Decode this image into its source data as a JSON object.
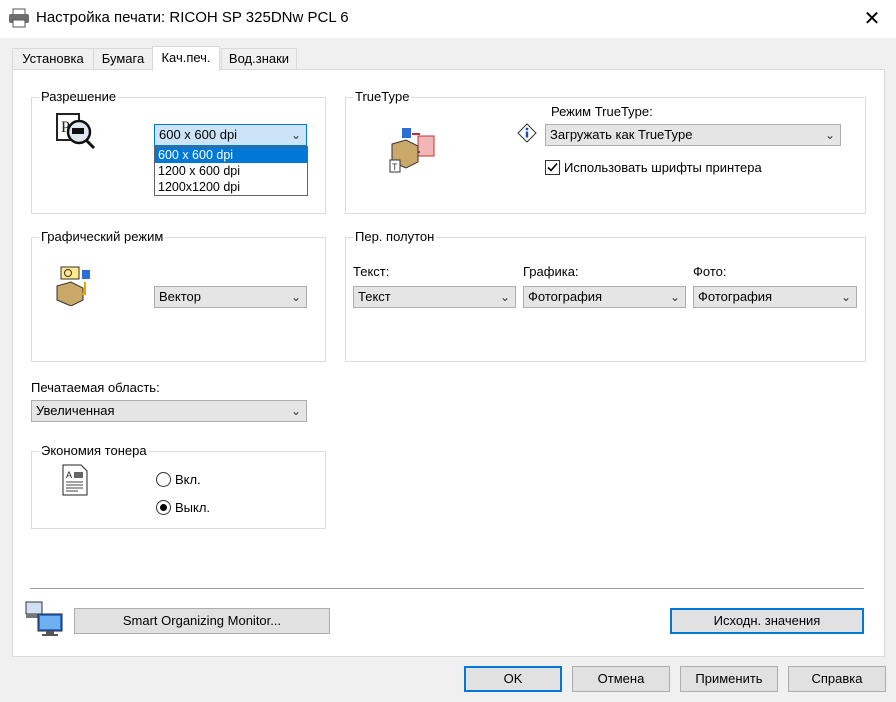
{
  "window": {
    "title": "Настройка печати: RICOH SP 325DNw PCL 6",
    "close_label": "✕"
  },
  "tabs": [
    {
      "label": "Установка"
    },
    {
      "label": "Бумага"
    },
    {
      "label": "Кач.печ."
    },
    {
      "label": "Вод.знаки"
    }
  ],
  "resolution": {
    "group_label": "Разрешение",
    "selected": "600 x 600 dpi",
    "options": [
      "600 x 600 dpi",
      "1200 x 600 dpi",
      "1200x1200 dpi"
    ]
  },
  "truetype": {
    "group_label": "TrueType",
    "mode_label": "Режим TrueType:",
    "mode_value": "Загружать как TrueType",
    "use_printer_fonts_label": "Использовать шрифты принтера",
    "use_printer_fonts_checked": true
  },
  "graphics": {
    "group_label": "Графический режим",
    "value": "Вектор"
  },
  "halftone": {
    "group_label": "Пер. полутон",
    "text_label": "Текст:",
    "text_value": "Текст",
    "graphics_label": "Графика:",
    "graphics_value": "Фотография",
    "photo_label": "Фото:",
    "photo_value": "Фотография"
  },
  "print_area": {
    "label": "Печатаемая область:",
    "value": "Увеличенная"
  },
  "toner_saving": {
    "group_label": "Экономия тонера",
    "on_label": "Вкл.",
    "off_label": "Выкл.",
    "selected": "off"
  },
  "smart_monitor_button": "Smart Organizing Monitor...",
  "defaults_button": "Исходн. значения",
  "footer": {
    "ok": "OK",
    "cancel": "Отмена",
    "apply": "Применить",
    "help": "Справка"
  }
}
